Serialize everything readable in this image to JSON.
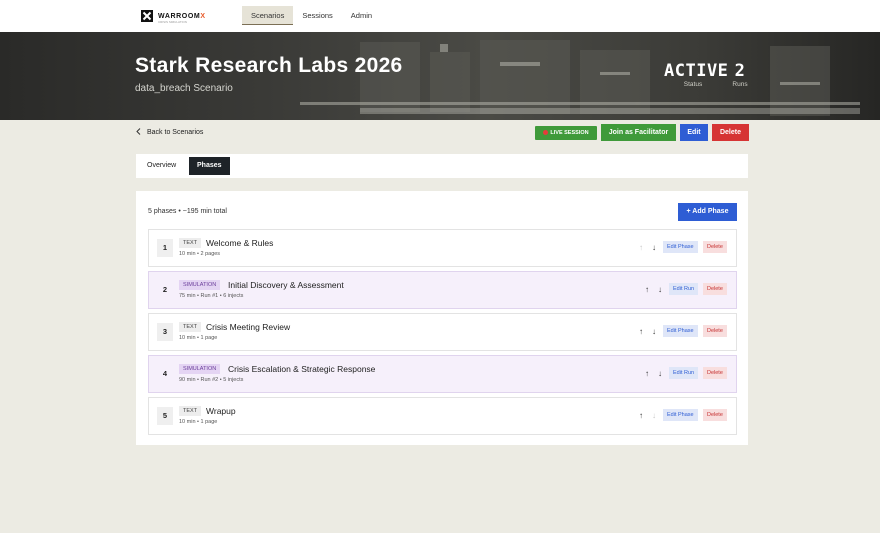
{
  "nav": {
    "logo_text": "WARROOM",
    "logo_accent": "X",
    "logo_sub": "CRISIS SIMULATION",
    "tabs": [
      "Scenarios",
      "Sessions",
      "Admin"
    ],
    "active_tab": "Scenarios"
  },
  "hero": {
    "title": "Stark Research Labs 2026",
    "subtitle": "data_breach Scenario",
    "status_value": "ACTIVE",
    "status_label": "Status",
    "runs_value": "2",
    "runs_label": "Runs"
  },
  "actions": {
    "back_label": "Back to Scenarios",
    "live_label": "LIVE SESSION",
    "join_label": "Join as Facilitator",
    "edit_label": "Edit",
    "delete_label": "Delete"
  },
  "tabs": {
    "overview": "Overview",
    "phases": "Phases",
    "active": "Phases"
  },
  "phases_panel": {
    "summary": "5 phases • ~195 min total",
    "add_label": "+ Add Phase",
    "items": [
      {
        "num": "1",
        "type": "TEXT",
        "title": "Welcome & Rules",
        "meta": "10 min • 2 pages",
        "edit_label": "Edit Phase",
        "delete_label": "Delete",
        "up_enabled": false,
        "down_enabled": true
      },
      {
        "num": "2",
        "type": "SIMULATION",
        "title": "Initial Discovery & Assessment",
        "meta": "75 min • Run #1 • 6 injects",
        "edit_label": "Edit Run",
        "delete_label": "Delete",
        "up_enabled": true,
        "down_enabled": true
      },
      {
        "num": "3",
        "type": "TEXT",
        "title": "Crisis Meeting Review",
        "meta": "10 min • 1 page",
        "edit_label": "Edit Phase",
        "delete_label": "Delete",
        "up_enabled": true,
        "down_enabled": true
      },
      {
        "num": "4",
        "type": "SIMULATION",
        "title": "Crisis Escalation & Strategic Response",
        "meta": "90 min • Run #2 • 5 injects",
        "edit_label": "Edit Run",
        "delete_label": "Delete",
        "up_enabled": true,
        "down_enabled": true
      },
      {
        "num": "5",
        "type": "TEXT",
        "title": "Wrapup",
        "meta": "10 min • 1 page",
        "edit_label": "Edit Phase",
        "delete_label": "Delete",
        "up_enabled": true,
        "down_enabled": false
      }
    ]
  },
  "colors": {
    "primary_blue": "#2e5dd4",
    "success_green": "#3f9a3a",
    "danger_red": "#d63434",
    "simulation_purple": "#6a3c9a",
    "page_bg": "#ecebe3"
  }
}
